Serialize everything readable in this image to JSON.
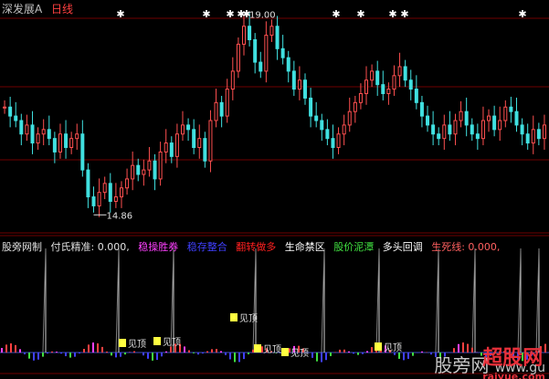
{
  "header": {
    "stock_name": "深发展A",
    "period": "日线",
    "colors": {
      "stock_name": "#c0c0c0",
      "period": "#ff4040"
    }
  },
  "price_panel": {
    "high_label": "19.00",
    "low_label": "14.86"
  },
  "indicator_panel": {
    "title": "股旁网制",
    "labels": [
      {
        "text": "付氏精准: 0.000,",
        "color": "#e0e0e0"
      },
      {
        "text": "稳操胜券",
        "color": "#ff40ff"
      },
      {
        "text": "稳存整合",
        "color": "#4040ff"
      },
      {
        "text": "翻转做多",
        "color": "#ff2020"
      },
      {
        "text": "生命禁区",
        "color": "#ffffff"
      },
      {
        "text": "股价泥潭",
        "color": "#40e040"
      },
      {
        "text": "多头回调",
        "color": "#ffffff"
      },
      {
        "text": "生死线: 0.000,",
        "color": "#ff6060"
      }
    ],
    "markers": [
      "见顶",
      "见顶",
      "见顶",
      "见顶",
      "见顶",
      "见顶"
    ]
  },
  "watermarks": {
    "left": "股旁网",
    "url": "www.gu",
    "brand": "超股网",
    "brand_url": "raiyue.com"
  },
  "chart_data": {
    "type": "candlestick",
    "ylim": [
      14.5,
      19.3
    ],
    "candles_close_approx": [
      17.2,
      17.0,
      16.9,
      16.6,
      16.8,
      16.4,
      16.6,
      16.7,
      16.5,
      16.2,
      16.6,
      16.3,
      16.5,
      16.6,
      15.8,
      15.2,
      15.0,
      15.3,
      15.5,
      15.1,
      15.2,
      15.4,
      15.6,
      15.9,
      15.7,
      15.8,
      16.0,
      15.6,
      16.2,
      16.4,
      16.1,
      16.6,
      16.8,
      16.7,
      16.3,
      16.5,
      16.0,
      16.9,
      17.3,
      17.0,
      17.6,
      18.0,
      18.6,
      19.0,
      18.7,
      18.2,
      18.0,
      18.8,
      19.0,
      18.5,
      18.3,
      18.0,
      17.6,
      17.8,
      17.4,
      17.0,
      16.9,
      16.7,
      16.5,
      16.3,
      16.6,
      16.8,
      17.1,
      17.3,
      17.5,
      17.8,
      18.0,
      17.7,
      17.5,
      17.6,
      17.9,
      18.1,
      17.8,
      17.6,
      17.3,
      17.0,
      16.8,
      16.6,
      16.5,
      16.8,
      16.6,
      16.9,
      17.1,
      16.8,
      16.6,
      16.5,
      16.9,
      17.0,
      16.7,
      16.9,
      17.2,
      17.1,
      16.8,
      16.6,
      16.4,
      16.7,
      16.5,
      16.8
    ],
    "top_star_markers": 11
  }
}
